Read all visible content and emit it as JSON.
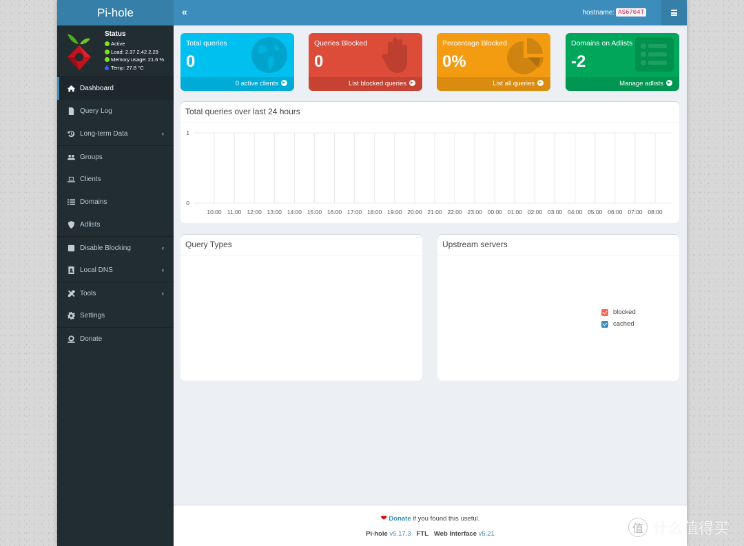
{
  "app": {
    "title": "Pi-hole"
  },
  "status": {
    "title": "Status",
    "active": "Active",
    "load": "Load:  2.37  2.42  2.29",
    "memory": "Memory usage:  21.6 %",
    "temp": "Temp: 27.8 °C",
    "colors": {
      "ok": "#7fe518",
      "temp": "#3366ff"
    }
  },
  "sidebar": {
    "items": [
      {
        "label": "Dashboard",
        "icon": "home-icon",
        "active": true,
        "submenu": false
      },
      {
        "label": "Query Log",
        "icon": "file-icon",
        "active": false,
        "submenu": false
      },
      {
        "label": "Long-term Data",
        "icon": "history-icon",
        "active": false,
        "submenu": true
      },
      {
        "label": "Groups",
        "icon": "users-icon",
        "active": false,
        "submenu": false
      },
      {
        "label": "Clients",
        "icon": "laptop-icon",
        "active": false,
        "submenu": false
      },
      {
        "label": "Domains",
        "icon": "list-icon",
        "active": false,
        "submenu": false
      },
      {
        "label": "Adlists",
        "icon": "shield-icon",
        "active": false,
        "submenu": false
      },
      {
        "label": "Disable Blocking",
        "icon": "stop-icon",
        "active": false,
        "submenu": true
      },
      {
        "label": "Local DNS",
        "icon": "address-book-icon",
        "active": false,
        "submenu": true
      },
      {
        "label": "Tools",
        "icon": "tools-icon",
        "active": false,
        "submenu": true
      },
      {
        "label": "Settings",
        "icon": "gear-icon",
        "active": false,
        "submenu": false
      },
      {
        "label": "Donate",
        "icon": "donate-icon",
        "active": false,
        "submenu": false
      }
    ]
  },
  "header": {
    "toggle_icon": "double-chevron-left-icon",
    "hostname_label": "hostname:",
    "hostname_value": "AS6704T",
    "menu_icon": "hamburger-icon"
  },
  "tiles": [
    {
      "title": "Total queries",
      "value": "0",
      "footer": "0 active clients",
      "color": "#00c0ef",
      "icon": "globe-icon"
    },
    {
      "title": "Queries Blocked",
      "value": "0",
      "footer": "List blocked queries",
      "color": "#dd4b39",
      "icon": "hand-icon"
    },
    {
      "title": "Percentage Blocked",
      "value": "0%",
      "footer": "List all queries",
      "color": "#f39c12",
      "icon": "pie-chart-icon"
    },
    {
      "title": "Domains on Adlists",
      "value": "-2",
      "footer": "Manage adlists",
      "color": "#00a65a",
      "icon": "list-alt-icon"
    }
  ],
  "panels": {
    "queries_over_time": {
      "title": "Total queries over last 24 hours"
    },
    "query_types": {
      "title": "Query Types"
    },
    "upstream_servers": {
      "title": "Upstream servers",
      "legend": [
        {
          "label": "blocked",
          "color": "#f56954",
          "checked": true
        },
        {
          "label": "cached",
          "color": "#3c8dbc",
          "checked": true
        }
      ]
    }
  },
  "chart_data": {
    "type": "bar",
    "title": "Total queries over last 24 hours",
    "xlabel": "",
    "ylabel": "",
    "categories": [
      "10:00",
      "11:00",
      "12:00",
      "13:00",
      "14:00",
      "15:00",
      "16:00",
      "17:00",
      "18:00",
      "19:00",
      "20:00",
      "21:00",
      "22:00",
      "23:00",
      "00:00",
      "01:00",
      "02:00",
      "03:00",
      "04:00",
      "05:00",
      "06:00",
      "07:00",
      "08:00"
    ],
    "values": [
      0,
      0,
      0,
      0,
      0,
      0,
      0,
      0,
      0,
      0,
      0,
      0,
      0,
      0,
      0,
      0,
      0,
      0,
      0,
      0,
      0,
      0,
      0
    ],
    "yticks": [
      "0",
      "1"
    ],
    "ylim": [
      0,
      1
    ],
    "grid": true,
    "legend": "none"
  },
  "footer": {
    "donate_link": "Donate",
    "donate_text": " if you found this useful.",
    "pihole_label": "Pi-hole",
    "pihole_version": "v5.17.3",
    "ftl_label": "FTL",
    "web_label": "Web Interface",
    "web_version": "v5.21"
  },
  "watermark": {
    "icon_char": "值",
    "text": "什么值得买"
  }
}
